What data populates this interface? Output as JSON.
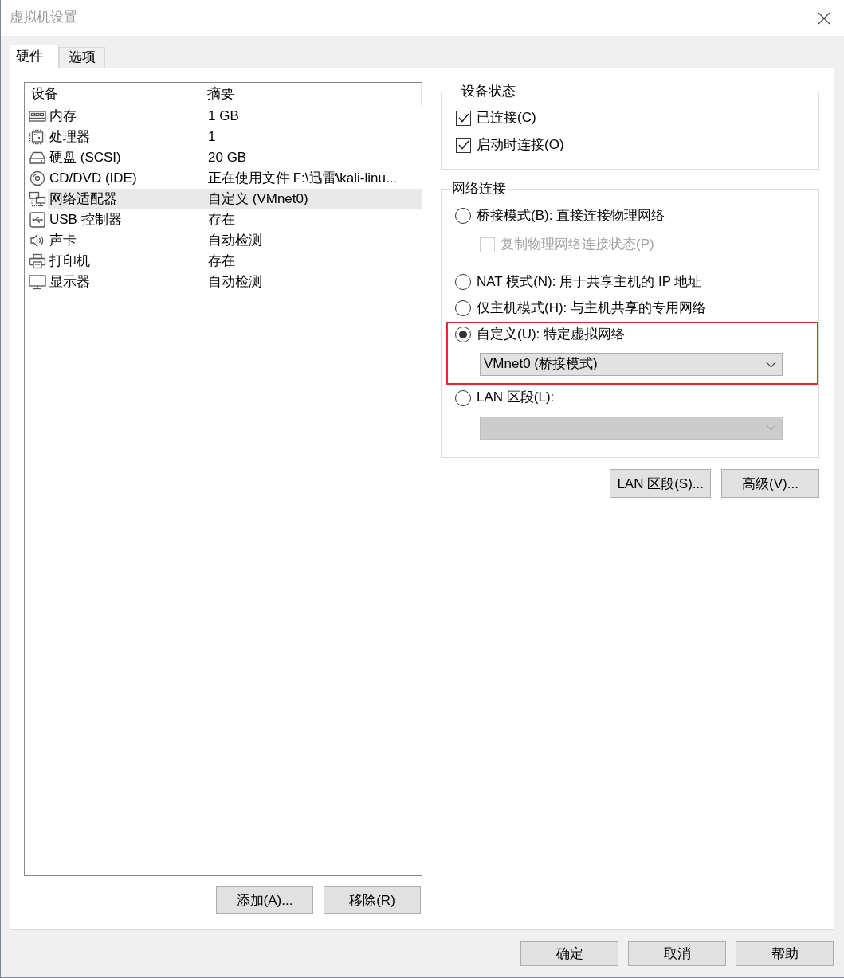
{
  "window": {
    "title": "虚拟机设置"
  },
  "tabs": [
    {
      "label": "硬件",
      "selected": true
    },
    {
      "label": "选项",
      "selected": false
    }
  ],
  "devices": {
    "columns": [
      "设备",
      "摘要"
    ],
    "rows": [
      {
        "kind": "memory",
        "device": "内存",
        "summary": "1 GB",
        "selected": false
      },
      {
        "kind": "processor",
        "device": "处理器",
        "summary": "1",
        "selected": false
      },
      {
        "kind": "hard_disk",
        "device": "硬盘 (SCSI)",
        "summary": "20 GB",
        "selected": false
      },
      {
        "kind": "cd_dvd",
        "device": "CD/DVD (IDE)",
        "summary": "正在使用文件 F:\\迅雷\\kali-linu...",
        "selected": false
      },
      {
        "kind": "network",
        "device": "网络适配器",
        "summary": "自定义 (VMnet0)",
        "selected": true
      },
      {
        "kind": "usb",
        "device": "USB 控制器",
        "summary": "存在",
        "selected": false
      },
      {
        "kind": "sound",
        "device": "声卡",
        "summary": "自动检测",
        "selected": false
      },
      {
        "kind": "printer",
        "device": "打印机",
        "summary": "存在",
        "selected": false
      },
      {
        "kind": "display",
        "device": "显示器",
        "summary": "自动检测",
        "selected": false
      }
    ],
    "buttons": [
      "添加(A)...",
      "移除(R)"
    ]
  },
  "device_status": {
    "title": "设备状态",
    "options": [
      {
        "label": "已连接(C)",
        "checked": true
      },
      {
        "label": "启动时连接(O)",
        "checked": true
      }
    ]
  },
  "network_connection": {
    "title": "网络连接",
    "options": [
      {
        "label": "桥接模式(B): 直接连接物理网络",
        "selected": false,
        "highlighted": false,
        "sub_option": {
          "label": "复制物理网络连接状态(P)",
          "checked": false,
          "disabled": true
        }
      },
      {
        "label": "NAT 模式(N): 用于共享主机的 IP 地址",
        "selected": false,
        "highlighted": false
      },
      {
        "label": "仅主机模式(H): 与主机共享的专用网络",
        "selected": false,
        "highlighted": false
      },
      {
        "label": "自定义(U): 特定虚拟网络",
        "selected": true,
        "highlighted": true,
        "dropdown": {
          "value": "VMnet0 (桥接模式)",
          "disabled": false
        }
      },
      {
        "label": "LAN 区段(L):",
        "selected": false,
        "highlighted": false,
        "dropdown": {
          "disabled": true
        }
      }
    ],
    "buttons": [
      "LAN 区段(S)...",
      "高级(V)..."
    ]
  },
  "dialog_buttons": [
    "确定",
    "取消",
    "帮助"
  ]
}
